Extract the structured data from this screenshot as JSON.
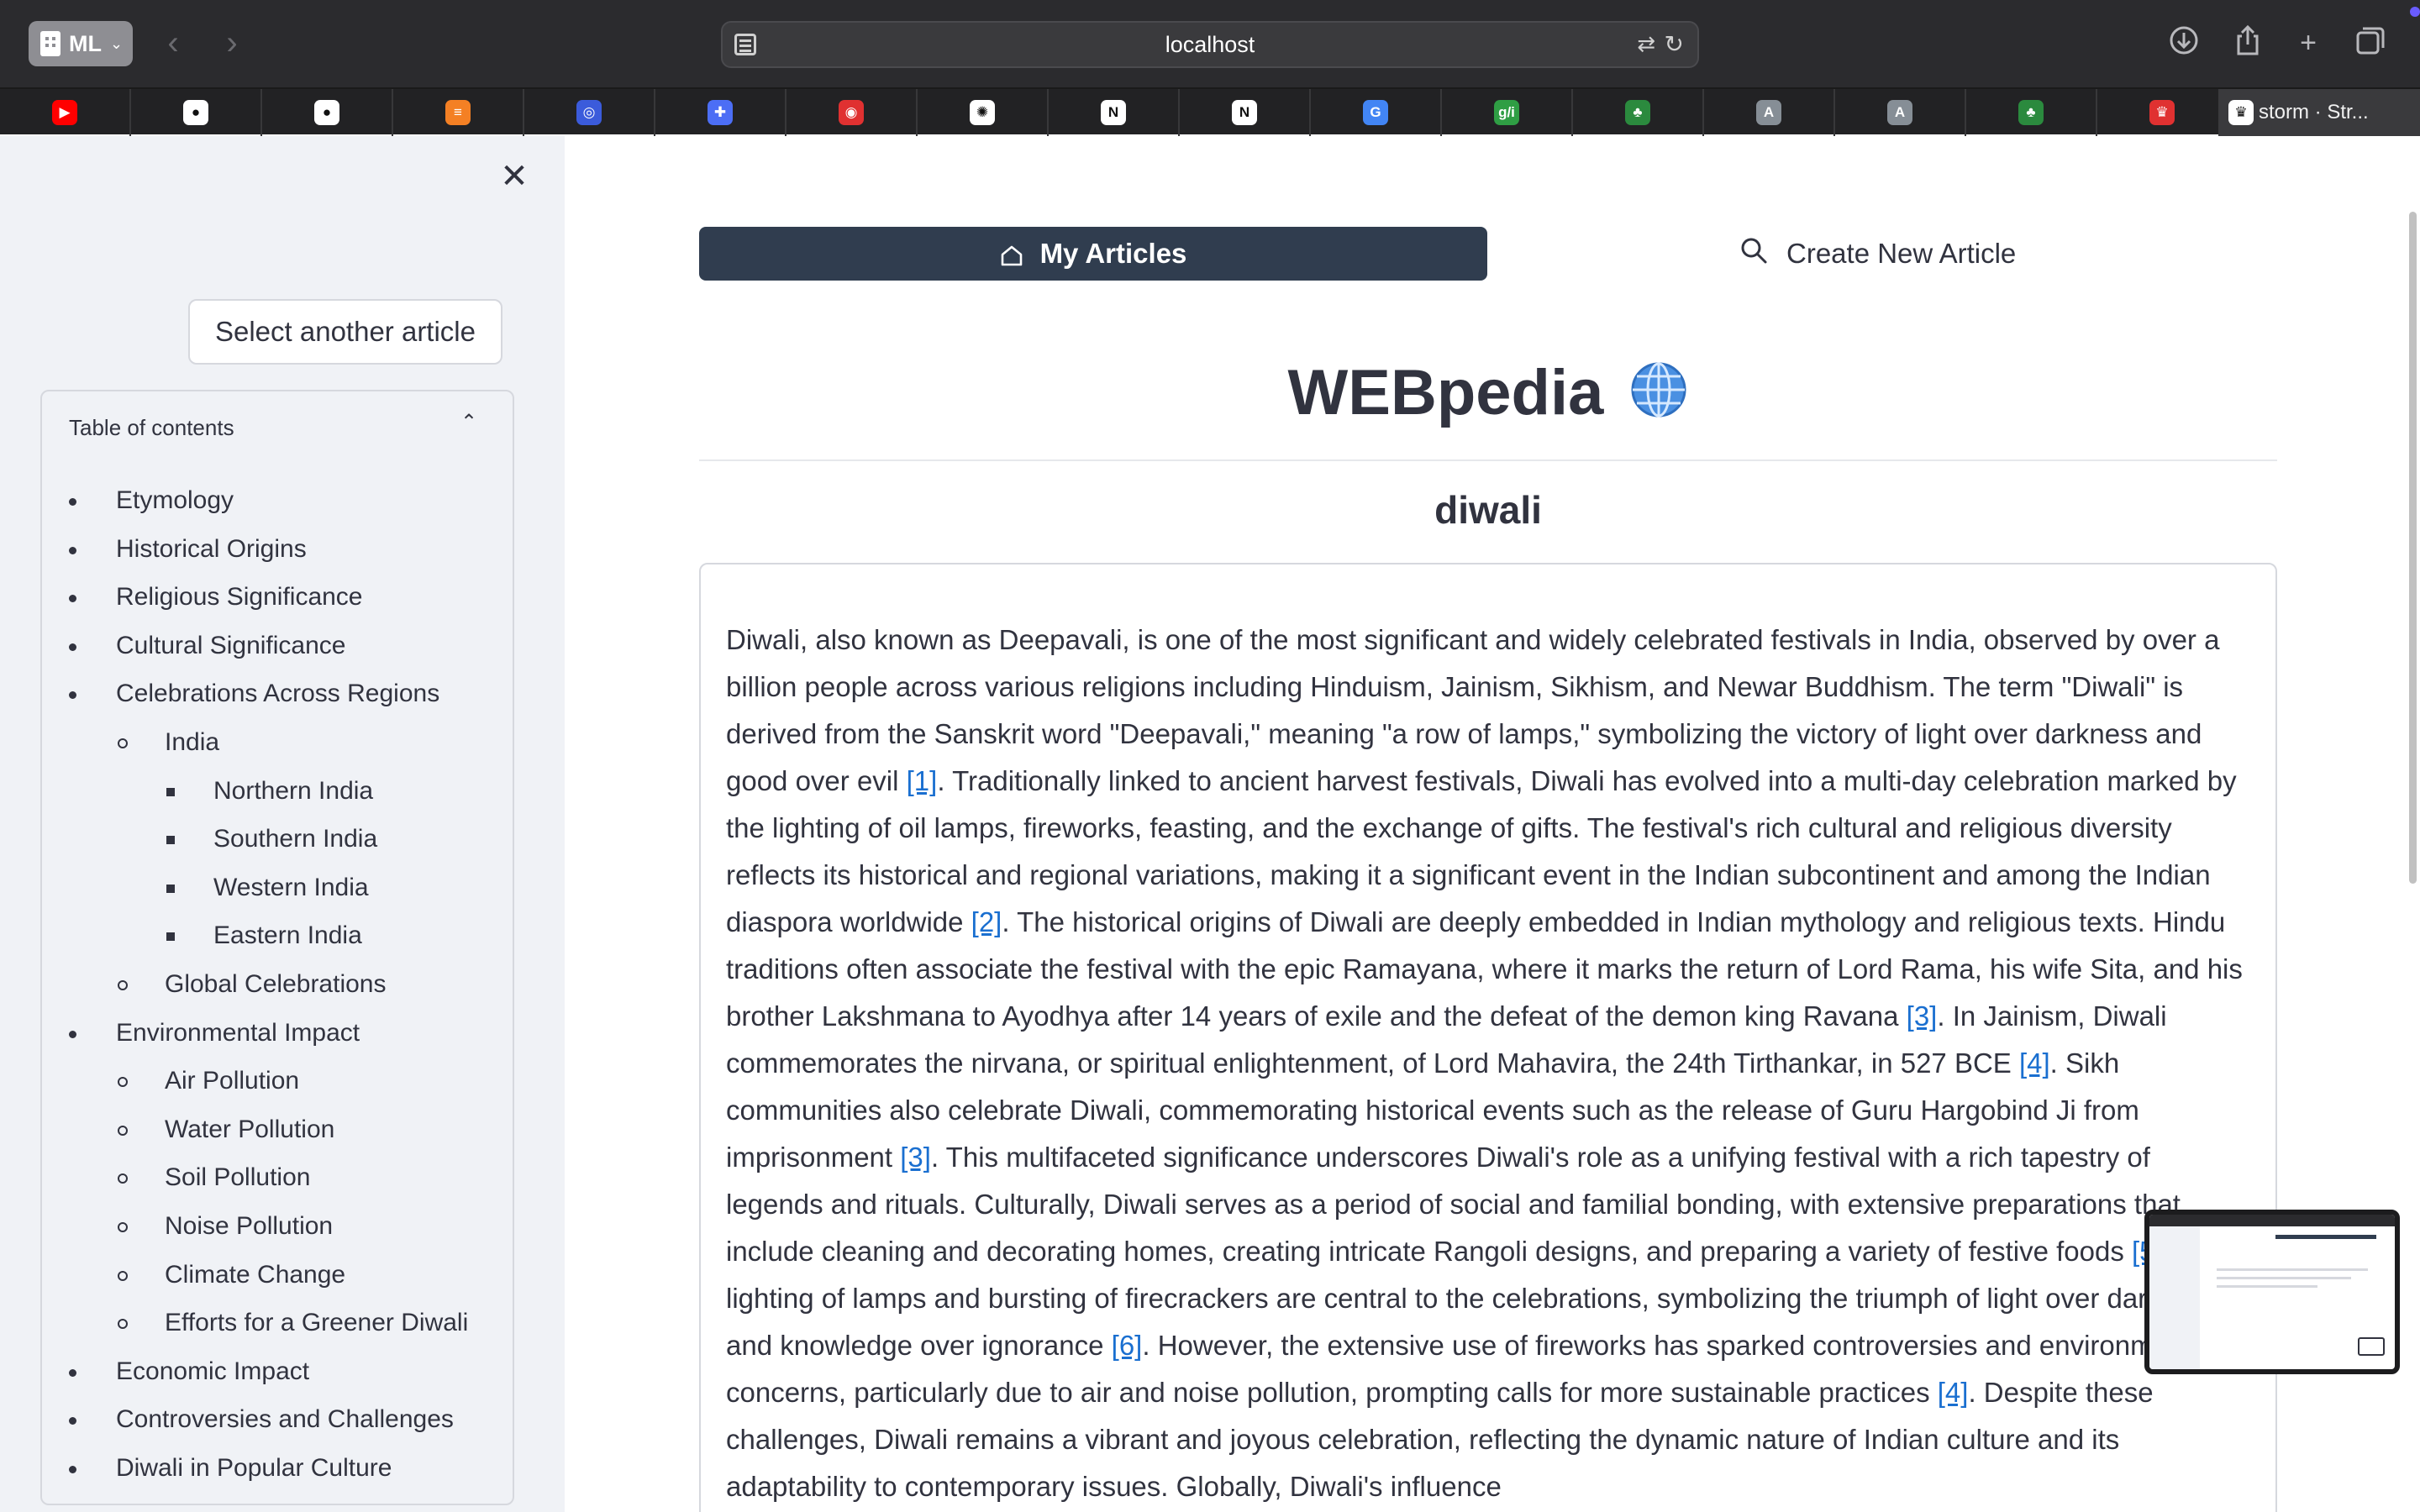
{
  "browser": {
    "profile_label": "ML",
    "address_url": "localhost",
    "active_tab_title": "storm · Str..."
  },
  "sidebar": {
    "select_button_label": "Select another article",
    "toc_title": "Table of contents",
    "toc_items": [
      {
        "label": "Etymology",
        "level": 1
      },
      {
        "label": "Historical Origins",
        "level": 1
      },
      {
        "label": "Religious Significance",
        "level": 1
      },
      {
        "label": "Cultural Significance",
        "level": 1
      },
      {
        "label": "Celebrations Across Regions",
        "level": 1
      },
      {
        "label": "India",
        "level": 2
      },
      {
        "label": "Northern India",
        "level": 3
      },
      {
        "label": "Southern India",
        "level": 3
      },
      {
        "label": "Western India",
        "level": 3
      },
      {
        "label": "Eastern India",
        "level": 3
      },
      {
        "label": "Global Celebrations",
        "level": 2
      },
      {
        "label": "Environmental Impact",
        "level": 1
      },
      {
        "label": "Air Pollution",
        "level": 2
      },
      {
        "label": "Water Pollution",
        "level": 2
      },
      {
        "label": "Soil Pollution",
        "level": 2
      },
      {
        "label": "Noise Pollution",
        "level": 2
      },
      {
        "label": "Climate Change",
        "level": 2
      },
      {
        "label": "Efforts for a Greener Diwali",
        "level": 2
      },
      {
        "label": "Economic Impact",
        "level": 1
      },
      {
        "label": "Controversies and Challenges",
        "level": 1
      },
      {
        "label": "Diwali in Popular Culture",
        "level": 1
      }
    ]
  },
  "main": {
    "my_articles_label": "My Articles",
    "create_new_label": "Create New Article",
    "brand_title": "WEBpedia",
    "article_title": "diwali",
    "article_segments": [
      {
        "text": "Diwali, also known as Deepavali, is one of the most significant and widely celebrated festivals in India, observed by over a billion people across various religions including Hinduism, Jainism, Sikhism, and Newar Buddhism. The term \"Diwali\" is derived from the Sanskrit word \"Deepavali,\" meaning \"a row of lamps,\" symbolizing the victory of light over darkness and good over evil "
      },
      {
        "cite": "[1]"
      },
      {
        "text": ". Traditionally linked to ancient harvest festivals, Diwali has evolved into a multi-day celebration marked by the lighting of oil lamps, fireworks, feasting, and the exchange of gifts. The festival's rich cultural and religious diversity reflects its historical and regional variations, making it a significant event in the Indian subcontinent and among the Indian diaspora worldwide "
      },
      {
        "cite": "[2]"
      },
      {
        "text": ". The historical origins of Diwali are deeply embedded in Indian mythology and religious texts. Hindu traditions often associate the festival with the epic Ramayana, where it marks the return of Lord Rama, his wife Sita, and his brother Lakshmana to Ayodhya after 14 years of exile and the defeat of the demon king Ravana "
      },
      {
        "cite": "[3]"
      },
      {
        "text": ". In Jainism, Diwali commemorates the nirvana, or spiritual enlightenment, of Lord Mahavira, the 24th Tirthankar, in 527 BCE "
      },
      {
        "cite": "[4]"
      },
      {
        "text": ". Sikh communities also celebrate Diwali, commemorating historical events such as the release of Guru Hargobind Ji from imprisonment "
      },
      {
        "cite": "[3]"
      },
      {
        "text": ". This multifaceted significance underscores Diwali's role as a unifying festival with a rich tapestry of legends and rituals. Culturally, Diwali serves as a period of social and familial bonding, with extensive preparations that include cleaning and decorating homes, creating intricate Rangoli designs, and preparing a variety of festive foods "
      },
      {
        "cite": "[5]"
      },
      {
        "text": ". The lighting of lamps and bursting of firecrackers are central to the celebrations, symbolizing the triumph of light over darkness and knowledge over ignorance "
      },
      {
        "cite": "[6]"
      },
      {
        "text": ". However, the extensive use of fireworks has sparked controversies and environmental concerns, particularly due to air and noise pollution, prompting calls for more sustainable practices "
      },
      {
        "cite": "[4]"
      },
      {
        "text": ". Despite these challenges, Diwali remains a vibrant and joyous celebration, reflecting the dynamic nature of Indian culture and its adaptability to contemporary issues. Globally, Diwali's influence"
      }
    ]
  },
  "tab_favicons": [
    {
      "name": "youtube-favicon",
      "color": "#ff0000",
      "glyph": "▶"
    },
    {
      "name": "github-favicon",
      "color": "#ffffff",
      "glyph": "●"
    },
    {
      "name": "github-favicon",
      "color": "#ffffff",
      "glyph": "●"
    },
    {
      "name": "stackoverflow-favicon",
      "color": "#f48024",
      "glyph": "≡"
    },
    {
      "name": "blue-circle-favicon",
      "color": "#3b5bdb",
      "glyph": "◎"
    },
    {
      "name": "blue-square-favicon",
      "color": "#4c6ef5",
      "glyph": "✚"
    },
    {
      "name": "camera-favicon",
      "color": "#e03131",
      "glyph": "◉"
    },
    {
      "name": "openai-favicon",
      "color": "#ffffff",
      "glyph": "✺"
    },
    {
      "name": "notion-favicon",
      "color": "#ffffff",
      "glyph": "N"
    },
    {
      "name": "notion-favicon",
      "color": "#ffffff",
      "glyph": "N"
    },
    {
      "name": "google-favicon",
      "color": "#4285f4",
      "glyph": "G"
    },
    {
      "name": "gfi-favicon",
      "color": "#2f9e44",
      "glyph": "g/i"
    },
    {
      "name": "plant-favicon",
      "color": "#2b8a3e",
      "glyph": "♣"
    },
    {
      "name": "a-favicon",
      "color": "#868e96",
      "glyph": "A"
    },
    {
      "name": "a-favicon",
      "color": "#868e96",
      "glyph": "A"
    },
    {
      "name": "plant-favicon",
      "color": "#2b8a3e",
      "glyph": "♣"
    },
    {
      "name": "red-crown-favicon",
      "color": "#e03131",
      "glyph": "♛"
    }
  ]
}
